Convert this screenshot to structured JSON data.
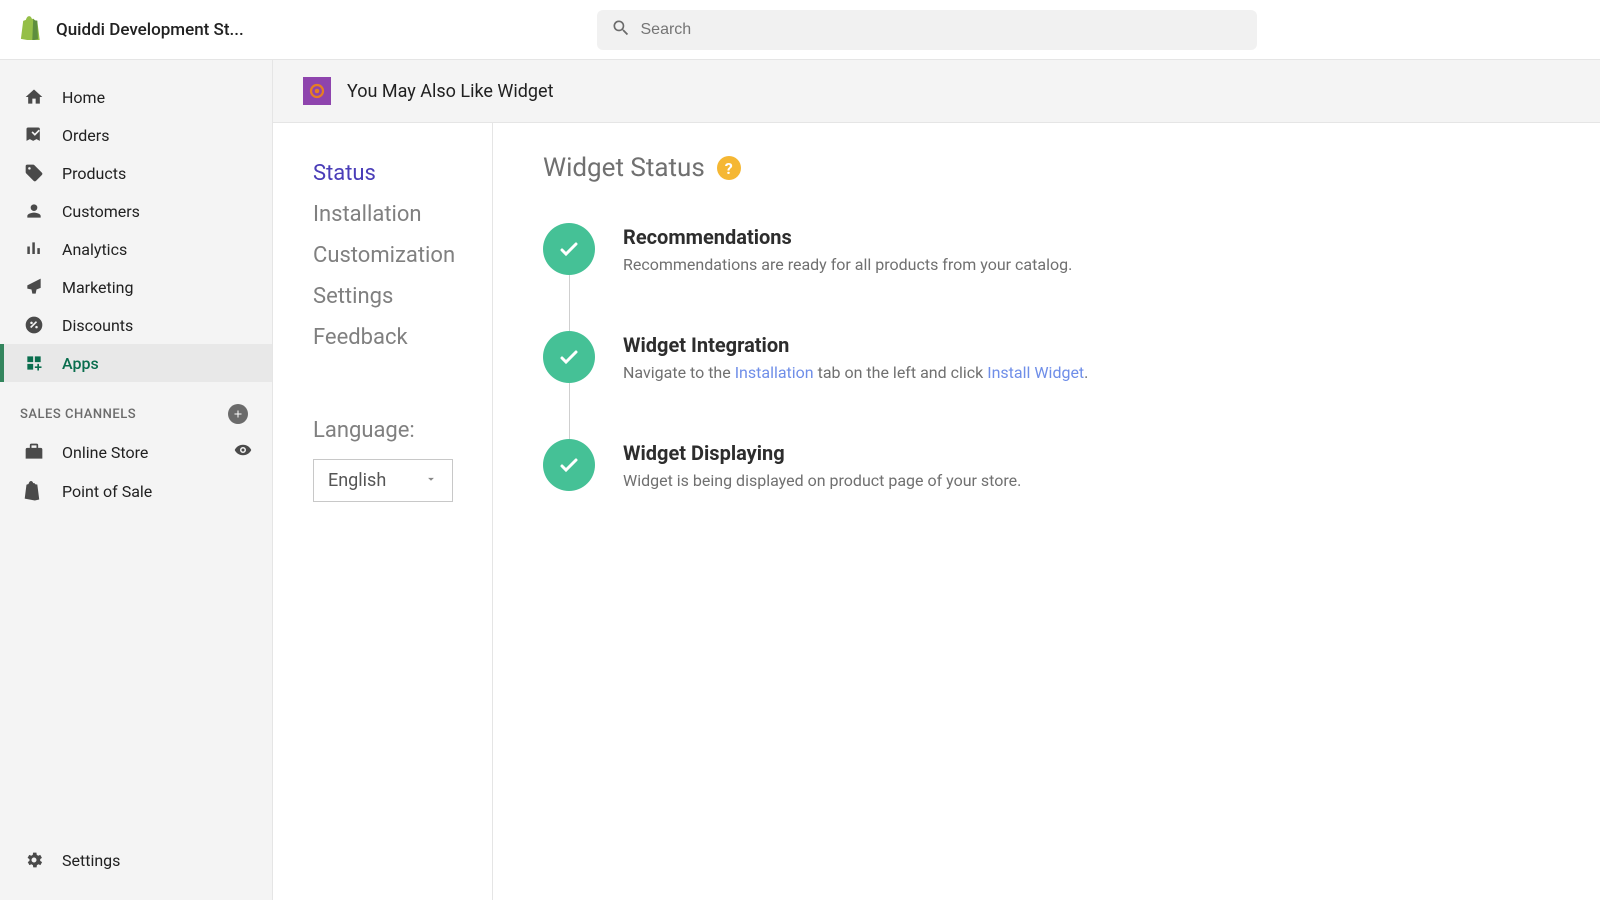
{
  "header": {
    "store_name": "Quiddi Development St...",
    "search_placeholder": "Search"
  },
  "sidebar": {
    "items": [
      {
        "label": "Home"
      },
      {
        "label": "Orders"
      },
      {
        "label": "Products"
      },
      {
        "label": "Customers"
      },
      {
        "label": "Analytics"
      },
      {
        "label": "Marketing"
      },
      {
        "label": "Discounts"
      },
      {
        "label": "Apps"
      }
    ],
    "channels_header": "SALES CHANNELS",
    "channels": [
      {
        "label": "Online Store"
      },
      {
        "label": "Point of Sale"
      }
    ],
    "settings_label": "Settings"
  },
  "app": {
    "title": "You May Also Like Widget",
    "nav": [
      {
        "label": "Status"
      },
      {
        "label": "Installation"
      },
      {
        "label": "Customization"
      },
      {
        "label": "Settings"
      },
      {
        "label": "Feedback"
      }
    ],
    "language_label": "Language:",
    "language_value": "English"
  },
  "status": {
    "title": "Widget Status",
    "steps": [
      {
        "title": "Recommendations",
        "desc": "Recommendations are ready for all products from your catalog."
      },
      {
        "title": "Widget Integration",
        "desc_pre": "Navigate to the ",
        "link1": "Installation",
        "desc_mid": " tab on the left and click ",
        "link2": "Install Widget",
        "desc_post": "."
      },
      {
        "title": "Widget Displaying",
        "desc": "Widget is being displayed on product page of your store."
      }
    ]
  }
}
